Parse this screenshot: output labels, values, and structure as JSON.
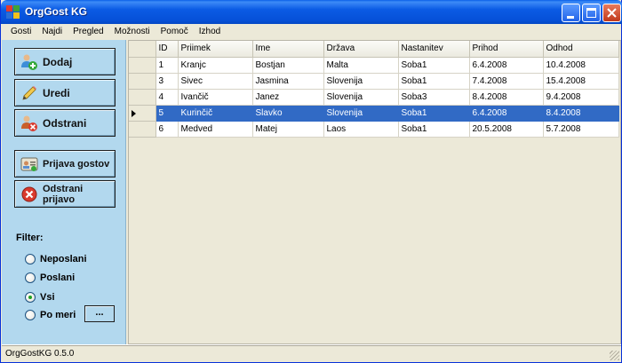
{
  "window": {
    "title": "OrgGost KG"
  },
  "menu": [
    "Gosti",
    "Najdi",
    "Pregled",
    "Možnosti",
    "Pomoč",
    "Izhod"
  ],
  "actions": {
    "add": "Dodaj",
    "edit": "Uredi",
    "remove": "Odstrani",
    "checkin": "Prijava gostov",
    "remove_checkin": "Odstrani prijavo"
  },
  "filter": {
    "label": "Filter:",
    "options": [
      "Neposlani",
      "Poslani",
      "Vsi",
      "Po meri"
    ],
    "selected": "Vsi",
    "browse_label": "..."
  },
  "grid": {
    "columns": [
      "ID",
      "Priimek",
      "Ime",
      "Država",
      "Nastanitev",
      "Prihod",
      "Odhod"
    ],
    "rows": [
      [
        "1",
        "Kranjc",
        "Bostjan",
        "Malta",
        "Soba1",
        "6.4.2008",
        "10.4.2008"
      ],
      [
        "3",
        "Sivec",
        "Jasmina",
        "Slovenija",
        "Soba1",
        "7.4.2008",
        "15.4.2008"
      ],
      [
        "4",
        "Ivančič",
        "Janez",
        "Slovenija",
        "Soba3",
        "8.4.2008",
        "9.4.2008"
      ],
      [
        "5",
        "Kurinčič",
        "Slavko",
        "Slovenija",
        "Soba1",
        "6.4.2008",
        "8.4.2008"
      ],
      [
        "6",
        "Medved",
        "Matej",
        "Laos",
        "Soba1",
        "20.5.2008",
        "5.7.2008"
      ]
    ],
    "selected_row": 3
  },
  "status": {
    "version": "OrgGostKG 0.5.0"
  },
  "icons": {
    "app": "app-grid-icon",
    "add": "add-user-icon",
    "edit": "pencil-icon",
    "remove": "remove-user-icon",
    "checkin": "checkin-card-icon",
    "remove_checkin": "red-x-icon"
  },
  "colors": {
    "accent": "#316ac5",
    "panel": "#b2d8ee",
    "titlebar": "#0b5be4"
  }
}
